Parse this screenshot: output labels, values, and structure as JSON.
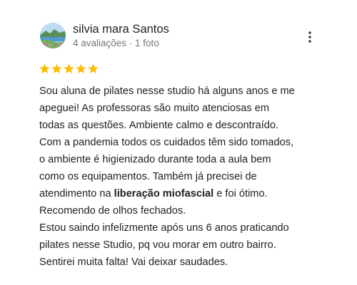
{
  "review": {
    "author_name": "silvia mara Santos",
    "author_meta": "4 avaliações · 1 foto",
    "rating": 5,
    "max_rating": 5,
    "star_color": "#fbbc04",
    "avatar_icon": "landscape-avatar",
    "menu_icon": "more-vert-icon",
    "text_lines": [
      "Sou aluna de pilates nesse studio há alguns anos e me",
      "apeguei! As professoras são muito atenciosas em",
      "todas as questões. Ambiente calmo e descontraído.",
      "Com a pandemia todos os cuidados têm sido tomados,",
      "o ambiente é higienizado durante toda a aula bem",
      "como os equipamentos. Também já precisei de"
    ],
    "bold_line": {
      "before": "atendimento na ",
      "bold": "liberação miofascial",
      "after": " e foi ótimo."
    },
    "text_lines_end": [
      "Recomendo de olhos fechados.",
      "Estou saindo infelizmente após uns 6 anos praticando",
      "pilates nesse Studio, pq vou morar em outro bairro.",
      "Sentirei muita falta! Vai deixar saudades."
    ]
  }
}
